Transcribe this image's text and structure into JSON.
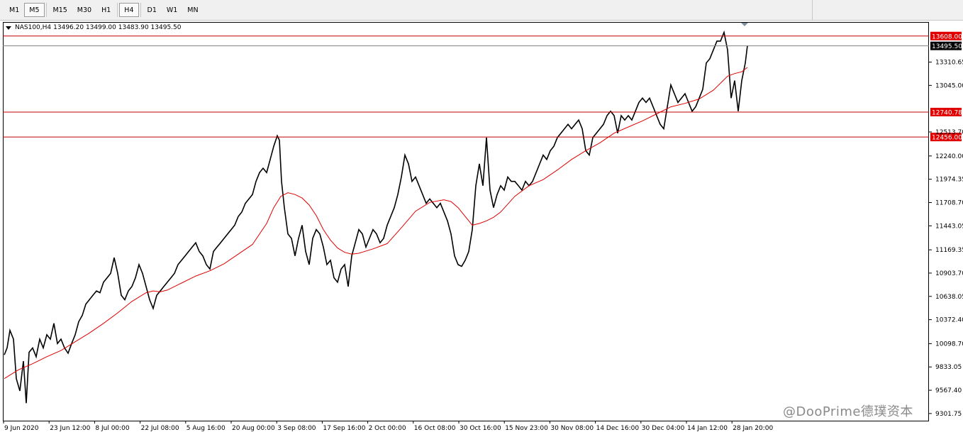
{
  "toolbar": {
    "timeframes": [
      {
        "label": "M1",
        "active": false
      },
      {
        "label": "M5",
        "active": true
      },
      {
        "label": "M15",
        "active": false
      },
      {
        "label": "M30",
        "active": false
      },
      {
        "label": "H1",
        "active": false
      },
      {
        "label": "H4",
        "active": true
      },
      {
        "label": "D1",
        "active": false
      },
      {
        "label": "W1",
        "active": false
      },
      {
        "label": "MN",
        "active": false
      }
    ]
  },
  "header": {
    "symbol": "NAS100,H4",
    "ohlc": "13496.20 13499.00 13483.90 13495.50"
  },
  "watermark": "@DooPrime德璞资本",
  "colors": {
    "candles": "#000000",
    "moving_average": "#e00000",
    "support_resistance": "#c00000",
    "current_price_line": "#808080"
  },
  "chart_data": {
    "type": "line",
    "title": "",
    "xlabel": "",
    "ylabel": "",
    "ylim": [
      9220,
      13760
    ],
    "price_axis_ticks": [
      "13310.65",
      "13045.00",
      "12513.70",
      "12240.00",
      "11974.35",
      "11708.70",
      "11443.05",
      "11169.35",
      "10903.70",
      "10638.05",
      "10372.40",
      "10098.70",
      "9833.05",
      "9567.40",
      "9301.75"
    ],
    "time_axis_ticks": [
      "9 Jun 2020",
      "23 Jun 12:00",
      "8 Jul 00:00",
      "22 Jul 08:00",
      "5 Aug 16:00",
      "20 Aug 00:00",
      "3 Sep 08:00",
      "17 Sep 16:00",
      "2 Oct 00:00",
      "16 Oct 08:00",
      "30 Oct 16:00",
      "15 Nov 23:00",
      "30 Nov 08:00",
      "14 Dec 16:00",
      "30 Dec 04:00",
      "14 Jan 12:00",
      "28 Jan 20:00"
    ],
    "horizontal_lines": [
      {
        "value": 13608.0,
        "label": "13608.00",
        "kind": "resistance"
      },
      {
        "value": 13495.5,
        "label": "13495.50",
        "kind": "current_price"
      },
      {
        "value": 12740.78,
        "label": "12740.78",
        "kind": "support"
      },
      {
        "value": 12456.0,
        "label": "12456.00",
        "kind": "support"
      }
    ],
    "series": [
      {
        "name": "",
        "values": [
          [
            0,
            9970
          ],
          [
            4,
            10050
          ],
          [
            8,
            10250
          ],
          [
            13,
            10150
          ],
          [
            17,
            9700
          ],
          [
            22,
            9560
          ],
          [
            27,
            9900
          ],
          [
            31,
            9420
          ],
          [
            35,
            10000
          ],
          [
            40,
            10050
          ],
          [
            45,
            9950
          ],
          [
            50,
            10150
          ],
          [
            55,
            10050
          ],
          [
            60,
            10200
          ],
          [
            65,
            10150
          ],
          [
            70,
            10330
          ],
          [
            75,
            10100
          ],
          [
            80,
            10150
          ],
          [
            85,
            10050
          ],
          [
            90,
            9990
          ],
          [
            95,
            10100
          ],
          [
            100,
            10200
          ],
          [
            105,
            10350
          ],
          [
            110,
            10420
          ],
          [
            115,
            10550
          ],
          [
            120,
            10600
          ],
          [
            125,
            10650
          ],
          [
            130,
            10700
          ],
          [
            135,
            10680
          ],
          [
            140,
            10800
          ],
          [
            145,
            10850
          ],
          [
            150,
            10900
          ],
          [
            155,
            11080
          ],
          [
            160,
            10900
          ],
          [
            165,
            10650
          ],
          [
            170,
            10600
          ],
          [
            175,
            10700
          ],
          [
            180,
            10750
          ],
          [
            185,
            10850
          ],
          [
            190,
            11000
          ],
          [
            195,
            10900
          ],
          [
            200,
            10750
          ],
          [
            205,
            10600
          ],
          [
            210,
            10500
          ],
          [
            215,
            10650
          ],
          [
            220,
            10700
          ],
          [
            225,
            10750
          ],
          [
            230,
            10800
          ],
          [
            235,
            10850
          ],
          [
            240,
            10900
          ],
          [
            245,
            11000
          ],
          [
            250,
            11050
          ],
          [
            255,
            11100
          ],
          [
            260,
            11150
          ],
          [
            265,
            11200
          ],
          [
            270,
            11250
          ],
          [
            275,
            11150
          ],
          [
            280,
            11100
          ],
          [
            285,
            11000
          ],
          [
            290,
            10950
          ],
          [
            295,
            11150
          ],
          [
            300,
            11200
          ],
          [
            305,
            11250
          ],
          [
            310,
            11300
          ],
          [
            315,
            11350
          ],
          [
            320,
            11400
          ],
          [
            325,
            11450
          ],
          [
            330,
            11550
          ],
          [
            335,
            11600
          ],
          [
            340,
            11700
          ],
          [
            345,
            11750
          ],
          [
            350,
            11800
          ],
          [
            355,
            11950
          ],
          [
            360,
            12050
          ],
          [
            365,
            12100
          ],
          [
            370,
            12050
          ],
          [
            375,
            12200
          ],
          [
            380,
            12350
          ],
          [
            385,
            12470
          ],
          [
            388,
            12420
          ],
          [
            391,
            11950
          ],
          [
            395,
            11650
          ],
          [
            400,
            11350
          ],
          [
            405,
            11300
          ],
          [
            410,
            11100
          ],
          [
            415,
            11300
          ],
          [
            420,
            11450
          ],
          [
            425,
            11150
          ],
          [
            430,
            11000
          ],
          [
            435,
            11300
          ],
          [
            440,
            11400
          ],
          [
            445,
            11350
          ],
          [
            450,
            11200
          ],
          [
            455,
            11000
          ],
          [
            460,
            11050
          ],
          [
            465,
            10850
          ],
          [
            470,
            10800
          ],
          [
            475,
            10950
          ],
          [
            480,
            11000
          ],
          [
            485,
            10750
          ],
          [
            490,
            11100
          ],
          [
            495,
            11250
          ],
          [
            500,
            11400
          ],
          [
            505,
            11350
          ],
          [
            510,
            11200
          ],
          [
            515,
            11300
          ],
          [
            520,
            11400
          ],
          [
            525,
            11350
          ],
          [
            530,
            11250
          ],
          [
            535,
            11300
          ],
          [
            540,
            11450
          ],
          [
            545,
            11550
          ],
          [
            550,
            11650
          ],
          [
            555,
            11800
          ],
          [
            560,
            12000
          ],
          [
            565,
            12250
          ],
          [
            570,
            12150
          ],
          [
            575,
            11950
          ],
          [
            580,
            12000
          ],
          [
            585,
            11900
          ],
          [
            590,
            11800
          ],
          [
            595,
            11700
          ],
          [
            600,
            11750
          ],
          [
            605,
            11700
          ],
          [
            610,
            11650
          ],
          [
            615,
            11700
          ],
          [
            620,
            11600
          ],
          [
            625,
            11500
          ],
          [
            630,
            11350
          ],
          [
            635,
            11100
          ],
          [
            640,
            11000
          ],
          [
            645,
            10980
          ],
          [
            650,
            11050
          ],
          [
            655,
            11150
          ],
          [
            660,
            11400
          ],
          [
            665,
            11900
          ],
          [
            670,
            12150
          ],
          [
            675,
            11900
          ],
          [
            680,
            12450
          ],
          [
            685,
            11850
          ],
          [
            690,
            11650
          ],
          [
            695,
            11800
          ],
          [
            700,
            11900
          ],
          [
            705,
            11850
          ],
          [
            710,
            12000
          ],
          [
            715,
            11950
          ],
          [
            720,
            11950
          ],
          [
            725,
            11900
          ],
          [
            730,
            11850
          ],
          [
            735,
            11950
          ],
          [
            740,
            11900
          ],
          [
            745,
            11950
          ],
          [
            750,
            12050
          ],
          [
            755,
            12150
          ],
          [
            760,
            12250
          ],
          [
            765,
            12200
          ],
          [
            770,
            12300
          ],
          [
            775,
            12350
          ],
          [
            780,
            12450
          ],
          [
            785,
            12500
          ],
          [
            790,
            12550
          ],
          [
            795,
            12600
          ],
          [
            800,
            12550
          ],
          [
            805,
            12600
          ],
          [
            810,
            12650
          ],
          [
            815,
            12550
          ],
          [
            820,
            12300
          ],
          [
            825,
            12250
          ],
          [
            830,
            12450
          ],
          [
            835,
            12500
          ],
          [
            840,
            12550
          ],
          [
            845,
            12600
          ],
          [
            850,
            12700
          ],
          [
            855,
            12750
          ],
          [
            860,
            12700
          ],
          [
            865,
            12500
          ],
          [
            870,
            12700
          ],
          [
            875,
            12650
          ],
          [
            880,
            12700
          ],
          [
            885,
            12650
          ],
          [
            890,
            12750
          ],
          [
            895,
            12850
          ],
          [
            900,
            12900
          ],
          [
            905,
            12850
          ],
          [
            910,
            12900
          ],
          [
            915,
            12800
          ],
          [
            920,
            12700
          ],
          [
            925,
            12600
          ],
          [
            930,
            12550
          ],
          [
            935,
            12800
          ],
          [
            940,
            13050
          ],
          [
            945,
            12950
          ],
          [
            950,
            12850
          ],
          [
            955,
            12900
          ],
          [
            960,
            12950
          ],
          [
            965,
            12850
          ],
          [
            970,
            12750
          ],
          [
            975,
            12800
          ],
          [
            980,
            12900
          ],
          [
            985,
            13000
          ],
          [
            990,
            13300
          ],
          [
            995,
            13350
          ],
          [
            1000,
            13450
          ],
          [
            1005,
            13550
          ],
          [
            1010,
            13550
          ],
          [
            1015,
            13650
          ],
          [
            1020,
            13450
          ],
          [
            1025,
            12900
          ],
          [
            1030,
            13100
          ],
          [
            1035,
            12750
          ],
          [
            1040,
            13100
          ],
          [
            1045,
            13300
          ],
          [
            1048,
            13500
          ]
        ]
      },
      {
        "name": "",
        "values": [
          [
            0,
            9700
          ],
          [
            20,
            9800
          ],
          [
            40,
            9870
          ],
          [
            60,
            9950
          ],
          [
            80,
            10020
          ],
          [
            100,
            10120
          ],
          [
            120,
            10220
          ],
          [
            140,
            10330
          ],
          [
            160,
            10450
          ],
          [
            180,
            10580
          ],
          [
            200,
            10680
          ],
          [
            210,
            10700
          ],
          [
            220,
            10690
          ],
          [
            230,
            10710
          ],
          [
            250,
            10790
          ],
          [
            270,
            10870
          ],
          [
            290,
            10930
          ],
          [
            310,
            11010
          ],
          [
            330,
            11120
          ],
          [
            350,
            11230
          ],
          [
            370,
            11470
          ],
          [
            380,
            11650
          ],
          [
            390,
            11780
          ],
          [
            400,
            11820
          ],
          [
            410,
            11800
          ],
          [
            420,
            11760
          ],
          [
            430,
            11680
          ],
          [
            440,
            11560
          ],
          [
            450,
            11400
          ],
          [
            460,
            11280
          ],
          [
            470,
            11190
          ],
          [
            480,
            11140
          ],
          [
            490,
            11120
          ],
          [
            500,
            11130
          ],
          [
            520,
            11180
          ],
          [
            540,
            11240
          ],
          [
            560,
            11420
          ],
          [
            580,
            11610
          ],
          [
            600,
            11710
          ],
          [
            620,
            11740
          ],
          [
            630,
            11720
          ],
          [
            640,
            11650
          ],
          [
            650,
            11550
          ],
          [
            660,
            11450
          ],
          [
            670,
            11470
          ],
          [
            680,
            11500
          ],
          [
            690,
            11540
          ],
          [
            700,
            11600
          ],
          [
            720,
            11780
          ],
          [
            740,
            11900
          ],
          [
            760,
            11970
          ],
          [
            780,
            12080
          ],
          [
            800,
            12200
          ],
          [
            820,
            12300
          ],
          [
            840,
            12390
          ],
          [
            860,
            12500
          ],
          [
            880,
            12570
          ],
          [
            900,
            12640
          ],
          [
            920,
            12720
          ],
          [
            940,
            12800
          ],
          [
            960,
            12840
          ],
          [
            980,
            12890
          ],
          [
            1000,
            12990
          ],
          [
            1020,
            13150
          ],
          [
            1030,
            13180
          ],
          [
            1040,
            13200
          ],
          [
            1048,
            13250
          ]
        ]
      }
    ]
  }
}
